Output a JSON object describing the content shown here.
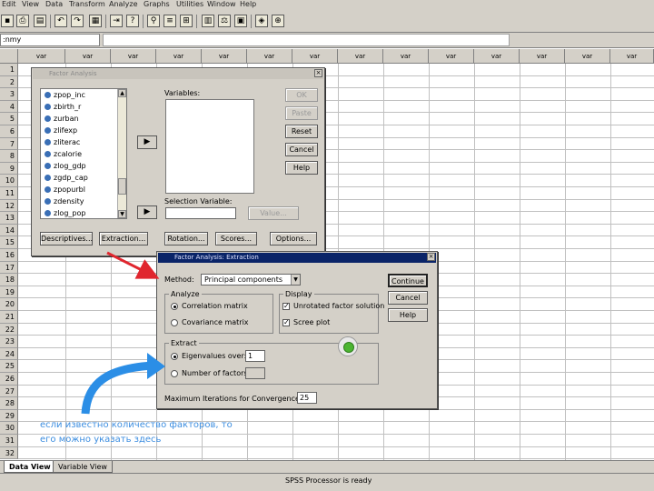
{
  "menubar": {
    "items": [
      "Edit",
      "View",
      "Data",
      "Transform",
      "Analyze",
      "Graphs",
      "Utilities",
      "Window",
      "Help"
    ]
  },
  "toolbar": {
    "icons": [
      "save-icon",
      "print-icon",
      "dialog-recall-icon",
      "undo-icon",
      "redo-icon",
      "goto-chart-icon",
      "goto-case-icon",
      "variables-icon",
      "find-icon",
      "insert-cases-icon",
      "insert-variable-icon",
      "split-file-icon",
      "weight-cases-icon",
      "select-cases-icon",
      "value-labels-icon",
      "use-sets-icon"
    ]
  },
  "formula_bar": {
    "cell_ref": ":nmy",
    "value": ""
  },
  "grid": {
    "column_header": "var",
    "rows": [
      "1",
      "2",
      "3",
      "4",
      "5",
      "6",
      "7",
      "8",
      "9",
      "10",
      "11",
      "12",
      "13",
      "14",
      "15",
      "16",
      "17",
      "18",
      "19",
      "20",
      "21",
      "22",
      "23",
      "24",
      "25",
      "26",
      "27",
      "28",
      "29",
      "30",
      "31",
      "32"
    ]
  },
  "factor_dialog": {
    "title": "Factor Analysis",
    "source_variables": [
      "zpop_inc",
      "zbirth_r",
      "zurban",
      "zlifexp",
      "zliterac",
      "zcalorie",
      "zlog_gdp",
      "zgdp_cap",
      "zpopurbl",
      "zdensity",
      "zlog_pop"
    ],
    "variables_label": "Variables:",
    "selection_label": "Selection Variable:",
    "buttons": {
      "ok": "OK",
      "paste": "Paste",
      "reset": "Reset",
      "cancel": "Cancel",
      "help": "Help",
      "value": "Value...",
      "descriptives": "Descriptives...",
      "extraction": "Extraction...",
      "rotation": "Rotation...",
      "scores": "Scores...",
      "options": "Options..."
    }
  },
  "extraction_dialog": {
    "title": "Factor Analysis: Extraction",
    "method_label": "Method:",
    "method_value": "Principal components",
    "analyze_group": "Analyze",
    "analyze_options": [
      "Correlation matrix",
      "Covariance matrix"
    ],
    "analyze_selected": 0,
    "display_group": "Display",
    "display_options": [
      {
        "label": "Unrotated factor solution",
        "checked": true
      },
      {
        "label": "Scree plot",
        "checked": true
      }
    ],
    "extract_group": "Extract",
    "eigen_label": "Eigenvalues over:",
    "eigen_value": "1",
    "factors_label": "Number of factors:",
    "factors_value": "",
    "extract_selected": 0,
    "max_iter_label": "Maximum Iterations for Convergence:",
    "max_iter_value": "25",
    "buttons": {
      "continue": "Continue",
      "cancel": "Cancel",
      "help": "Help"
    }
  },
  "tabs": {
    "data_view": "Data View",
    "variable_view": "Variable View"
  },
  "status": {
    "text": "SPSS Processor  is ready"
  },
  "annotation": {
    "line1": "если известно количество факторов, то",
    "line2": "его можно указать здесь"
  },
  "colors": {
    "arrow_red": "#e0262e",
    "arrow_blue": "#2b8ee6",
    "annotation_text": "#3d8ee0",
    "active_title": "#0a2468"
  }
}
